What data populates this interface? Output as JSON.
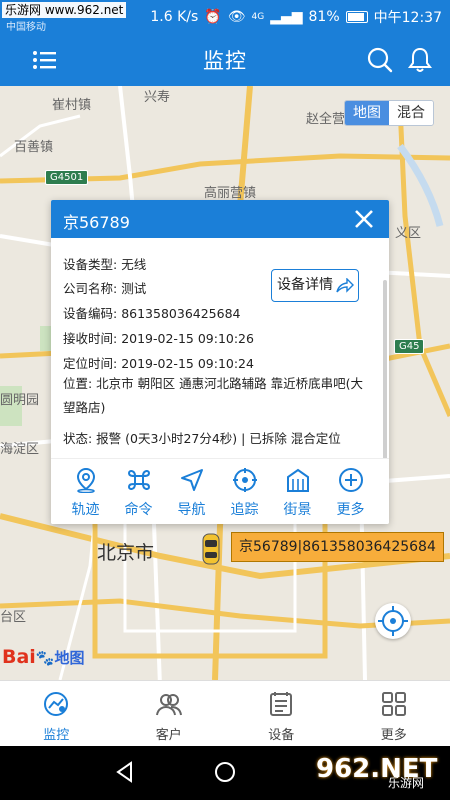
{
  "status_bar": {
    "watermark": "乐游网 www.962.net",
    "carrier": "中国移动",
    "speed": "1.6 K/s",
    "network": "4G",
    "battery": "81%",
    "time": "中午12:37"
  },
  "app_bar": {
    "title": "监控",
    "icons": [
      "menu-icon",
      "search-icon",
      "bell-icon"
    ]
  },
  "map": {
    "toggle": {
      "options": [
        "地图",
        "混合"
      ],
      "selected": "地图"
    },
    "labels": [
      {
        "key": "a",
        "text": "崔村镇"
      },
      {
        "key": "b",
        "text": "兴寿"
      },
      {
        "key": "c",
        "text": "百善镇"
      },
      {
        "key": "d",
        "text": "赵全营"
      },
      {
        "key": "e",
        "text": "高丽营镇"
      },
      {
        "key": "f",
        "text": "义区"
      },
      {
        "key": "g",
        "text": "圆明园"
      },
      {
        "key": "h",
        "text": "海淀区"
      },
      {
        "key": "i",
        "text": "北京市"
      },
      {
        "key": "j",
        "text": "台区"
      }
    ],
    "highway_shields": [
      "G4501",
      "G45"
    ],
    "logo": {
      "brand": "Bai",
      "suffix": "地图"
    },
    "vehicle_label": "京56789|861358036425684"
  },
  "popup": {
    "title": "京56789",
    "detail_button": "设备详情",
    "fields": [
      {
        "label": "设备类型:",
        "value": "无线"
      },
      {
        "label": "公司名称:",
        "value": "测试"
      },
      {
        "label": "设备编码:",
        "value": "861358036425684"
      },
      {
        "label": "接收时间:",
        "value": "2019-02-15 09:10:26"
      },
      {
        "label": "定位时间:",
        "value": "2019-02-15 09:10:24"
      }
    ],
    "location": "位置: 北京市 朝阳区 通惠河北路辅路 靠近桥底串吧(大望路店)",
    "status": "状态: 报警 (0天3小时27分4秒) | 已拆除 混合定位",
    "actions": [
      {
        "label": "轨迹",
        "icon": "location-pin-icon"
      },
      {
        "label": "命令",
        "icon": "command-icon"
      },
      {
        "label": "导航",
        "icon": "navigation-icon"
      },
      {
        "label": "追踪",
        "icon": "crosshair-icon"
      },
      {
        "label": "街景",
        "icon": "building-icon"
      },
      {
        "label": "更多",
        "icon": "plus-circle-icon"
      }
    ]
  },
  "bottom_nav": {
    "tabs": [
      {
        "label": "监控",
        "icon": "monitor-icon",
        "active": true
      },
      {
        "label": "客户",
        "icon": "users-icon",
        "active": false
      },
      {
        "label": "设备",
        "icon": "device-list-icon",
        "active": false
      },
      {
        "label": "更多",
        "icon": "grid-icon",
        "active": false
      }
    ]
  },
  "system_nav": {
    "watermark_text": "962.NET",
    "watermark_sub": "乐游网"
  },
  "colors": {
    "primary": "#1b7fd8",
    "label_orange": "#f7ad3b"
  }
}
